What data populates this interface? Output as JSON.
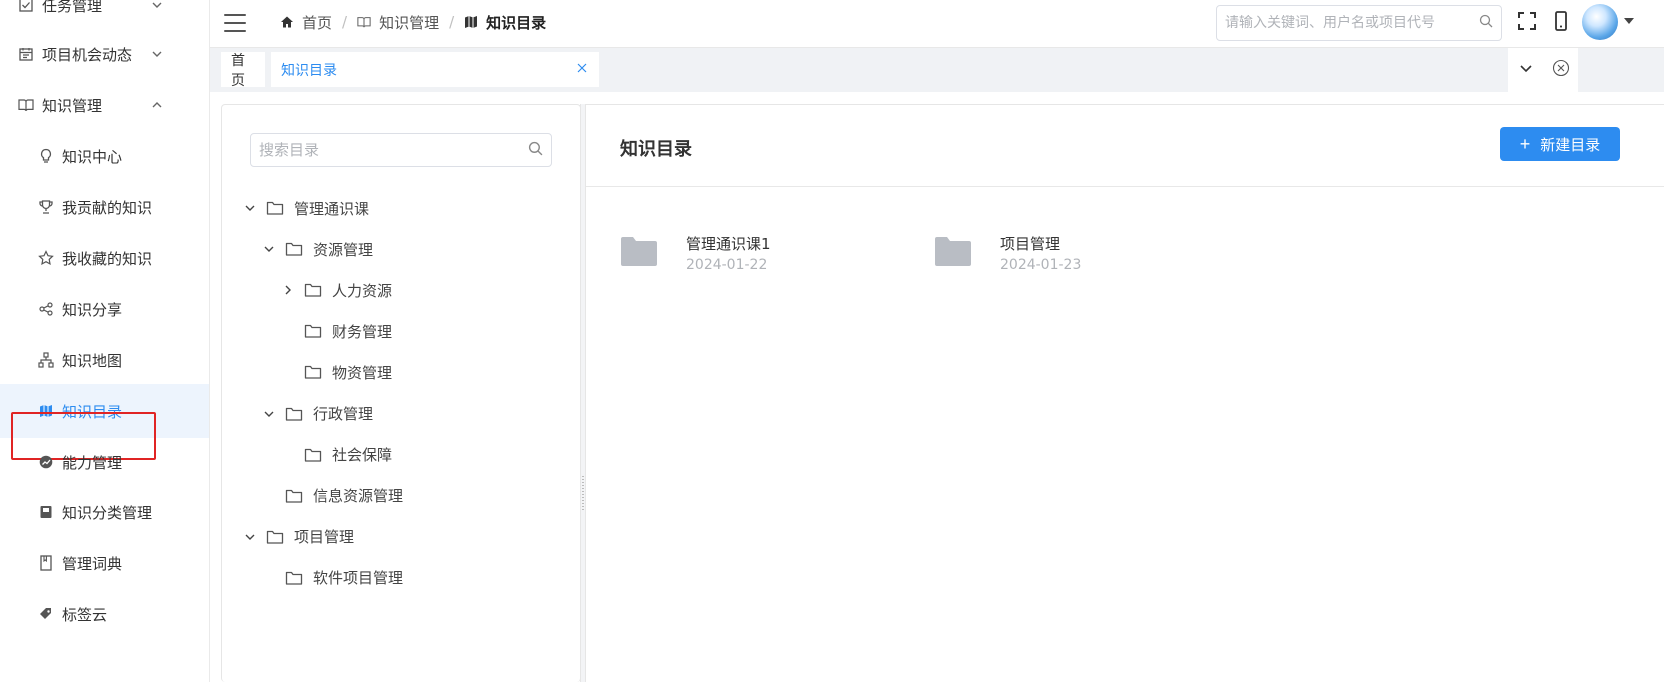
{
  "sidebar": {
    "items": [
      {
        "label": "任务管理",
        "icon": "checkbox-icon"
      },
      {
        "label": "项目机会动态",
        "icon": "calendar-icon"
      },
      {
        "label": "知识管理",
        "icon": "book-open-icon"
      },
      {
        "label": "知识中心",
        "icon": "lightbulb-icon"
      },
      {
        "label": "我贡献的知识",
        "icon": "trophy-icon"
      },
      {
        "label": "我收藏的知识",
        "icon": "star-icon"
      },
      {
        "label": "知识分享",
        "icon": "share-icon"
      },
      {
        "label": "知识地图",
        "icon": "sitemap-icon"
      },
      {
        "label": "知识目录",
        "icon": "map-icon",
        "active": true
      },
      {
        "label": "能力管理",
        "icon": "trend-icon"
      },
      {
        "label": "知识分类管理",
        "icon": "category-book-icon"
      },
      {
        "label": "管理词典",
        "icon": "dictionary-icon"
      },
      {
        "label": "标签云",
        "icon": "tag-icon"
      }
    ]
  },
  "header": {
    "breadcrumb": [
      "首页",
      "知识管理",
      "知识目录"
    ],
    "breadcrumb_sep": "/",
    "search_placeholder": "请输入关键词、用户名或项目代号"
  },
  "tabs": {
    "home": "首页",
    "current": "知识目录"
  },
  "tree": {
    "search_placeholder": "搜索目录",
    "nodes": [
      {
        "label": "管理通识课",
        "level": 0,
        "arrow": "expanded"
      },
      {
        "label": "资源管理",
        "level": 1,
        "arrow": "expanded"
      },
      {
        "label": "人力资源",
        "level": 2,
        "arrow": "collapsed"
      },
      {
        "label": "财务管理",
        "level": 2,
        "arrow": "none"
      },
      {
        "label": "物资管理",
        "level": 2,
        "arrow": "none"
      },
      {
        "label": "行政管理",
        "level": 1,
        "arrow": "expanded"
      },
      {
        "label": "社会保障",
        "level": 2,
        "arrow": "none"
      },
      {
        "label": "信息资源管理",
        "level": 1,
        "arrow": "none"
      },
      {
        "label": "项目管理",
        "level": 0,
        "arrow": "expanded"
      },
      {
        "label": "软件项目管理",
        "level": 1,
        "arrow": "none"
      }
    ]
  },
  "main": {
    "title": "知识目录",
    "new_button": "新建目录",
    "new_button_icon": "+",
    "directories": [
      {
        "name": "管理通识课1",
        "date": "2024-01-22"
      },
      {
        "name": "项目管理",
        "date": "2024-01-23"
      }
    ]
  },
  "colors": {
    "accent": "#2d8cf0",
    "active_bg": "#edf4fd",
    "highlight_outline": "#e02424",
    "folder_gray": "#b9bdc4"
  }
}
